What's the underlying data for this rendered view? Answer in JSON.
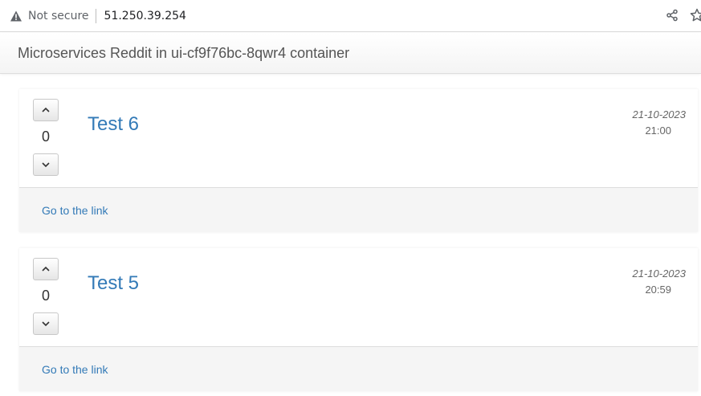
{
  "browser": {
    "security_label": "Not secure",
    "url": "51.250.39.254",
    "icons": [
      "warning-icon",
      "share-icon",
      "star-icon"
    ]
  },
  "navbar": {
    "brand": "Microservices Reddit in ui-cf9f76bc-8qwr4 container"
  },
  "posts": [
    {
      "title": "Test 6",
      "score": "0",
      "date": "21-10-2023",
      "time": "21:00",
      "link_label": "Go to the link"
    },
    {
      "title": "Test 5",
      "score": "0",
      "date": "21-10-2023",
      "time": "20:59",
      "link_label": "Go to the link"
    }
  ],
  "colors": {
    "link": "#337ab7",
    "footer_bg": "#f5f5f5"
  }
}
